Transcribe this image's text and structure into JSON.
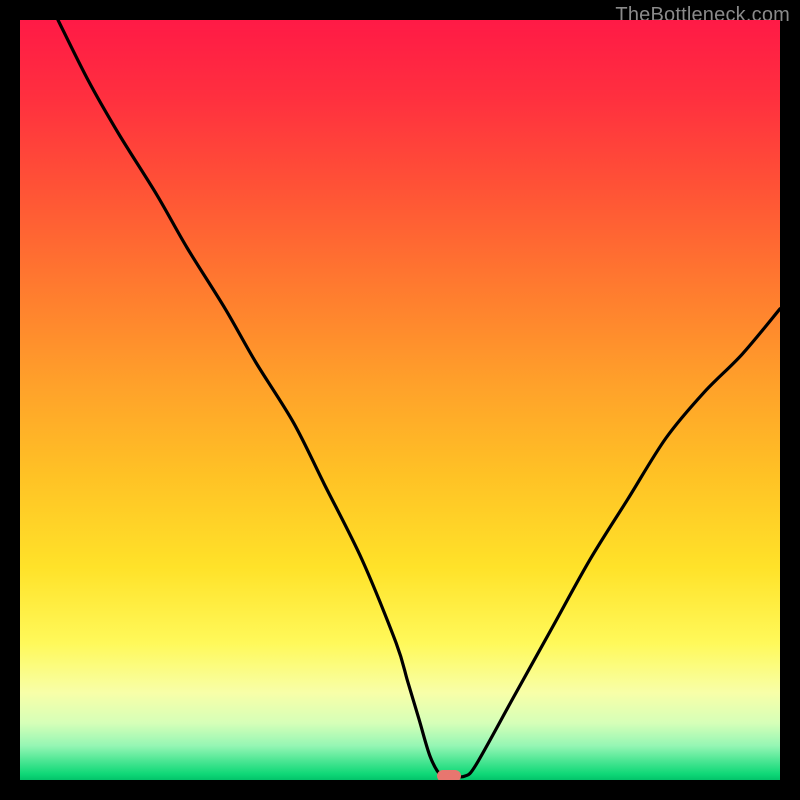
{
  "watermark": "TheBottleneck.com",
  "chart_data": {
    "type": "line",
    "title": "",
    "xlabel": "",
    "ylabel": "",
    "xlim": [
      0,
      100
    ],
    "ylim": [
      0,
      100
    ],
    "grid": false,
    "legend": false,
    "series": [
      {
        "name": "bottleneck-curve",
        "x": [
          5,
          9,
          13,
          18,
          22,
          27,
          31,
          36,
          40,
          45,
          49.5,
          51,
          52.5,
          54,
          55.5,
          57,
          58.5,
          60,
          65,
          70,
          75,
          80,
          85,
          90,
          95,
          100
        ],
        "y": [
          100,
          92,
          85,
          77,
          70,
          62,
          55,
          47,
          39,
          29,
          18,
          13,
          8,
          3,
          0.5,
          0.5,
          0.5,
          2,
          11,
          20,
          29,
          37,
          45,
          51,
          56,
          62
        ]
      }
    ],
    "marker": {
      "x": 56.5,
      "y": 0.5,
      "color": "#e8766f"
    },
    "gradient_stops": [
      {
        "offset": 0.0,
        "color": "#ff1a46"
      },
      {
        "offset": 0.1,
        "color": "#ff2f3f"
      },
      {
        "offset": 0.22,
        "color": "#ff5236"
      },
      {
        "offset": 0.35,
        "color": "#ff7a2f"
      },
      {
        "offset": 0.48,
        "color": "#ffa12a"
      },
      {
        "offset": 0.6,
        "color": "#ffc225"
      },
      {
        "offset": 0.72,
        "color": "#ffe229"
      },
      {
        "offset": 0.82,
        "color": "#fff95a"
      },
      {
        "offset": 0.885,
        "color": "#f8ffa8"
      },
      {
        "offset": 0.925,
        "color": "#d6ffb8"
      },
      {
        "offset": 0.955,
        "color": "#95f6b4"
      },
      {
        "offset": 0.975,
        "color": "#4be693"
      },
      {
        "offset": 0.992,
        "color": "#0fd877"
      },
      {
        "offset": 1.0,
        "color": "#03c36a"
      }
    ]
  }
}
